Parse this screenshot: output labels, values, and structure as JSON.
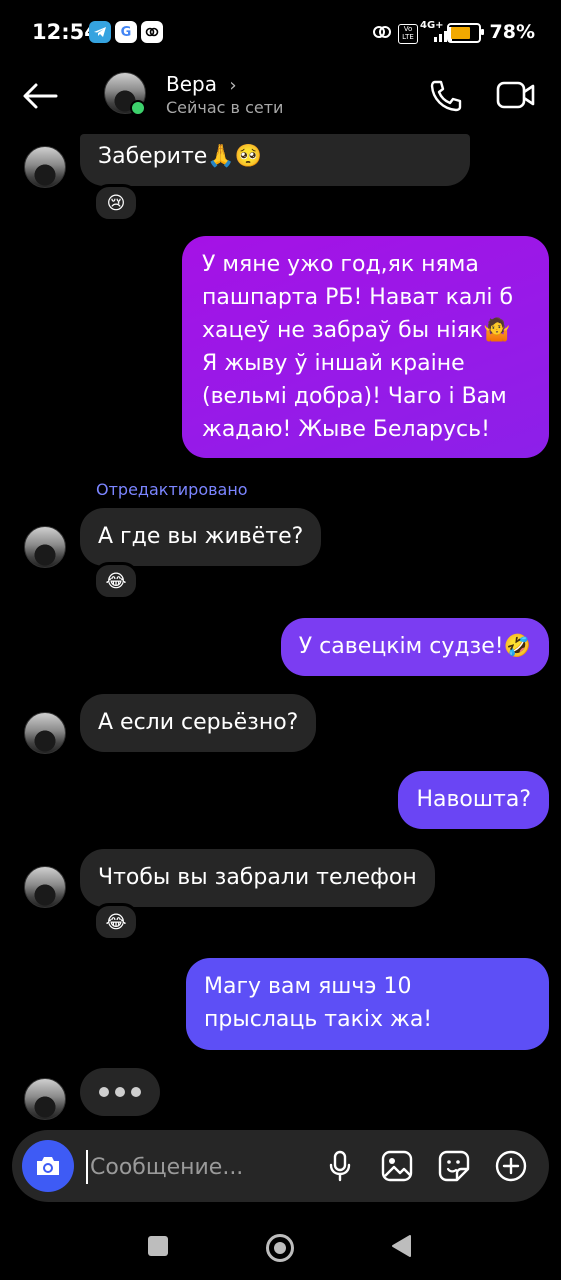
{
  "status_bar": {
    "time": "12:54",
    "apps": [
      "telegram",
      "google",
      "gallery"
    ],
    "battery_pct": "78%",
    "battery_level": 0.78,
    "network": "4G+"
  },
  "header": {
    "name": "Вера",
    "presence": "Сейчас в сети",
    "online": true
  },
  "messages": [
    {
      "dir": "in",
      "text": "Заберите🙏🥺",
      "reaction": "😢"
    },
    {
      "dir": "out",
      "text": "У мяне ужо год,як няма пашпарта РБ! Нават калі б хацеў не забраў бы ніяк🤷 Я жыву ў іншай краіне (вельмі добра)! Чаго і Вам жадаю! Жыве Беларусь!",
      "gradient": [
        "#a012e8",
        "#8e1fe8"
      ]
    },
    {
      "dir": "meta",
      "text": "Отредактировано"
    },
    {
      "dir": "in",
      "text": "А где вы живёте?",
      "reaction": "😂"
    },
    {
      "dir": "out",
      "text": "У савецкім судзе!🤣",
      "color": "#7b3df2"
    },
    {
      "dir": "in",
      "text": "А если серьёзно?"
    },
    {
      "dir": "out",
      "text": "Навошта?",
      "color": "#6a45f4"
    },
    {
      "dir": "in",
      "text": "Чтобы вы забрали телефон",
      "reaction": "😂"
    },
    {
      "dir": "out",
      "text": "Магу вам яшчэ 10 прыслаць такіх жа!",
      "color": "#5d4ff6"
    },
    {
      "dir": "typing"
    }
  ],
  "composer": {
    "placeholder": "Сообщение...",
    "icons": [
      "camera-icon",
      "microphone-icon",
      "image-icon",
      "sticker-icon",
      "plus-icon"
    ]
  },
  "colors": {
    "incoming_bubble": "#262626",
    "accent_blue": "#3e5bf5",
    "edited_label": "#7b85ff"
  }
}
